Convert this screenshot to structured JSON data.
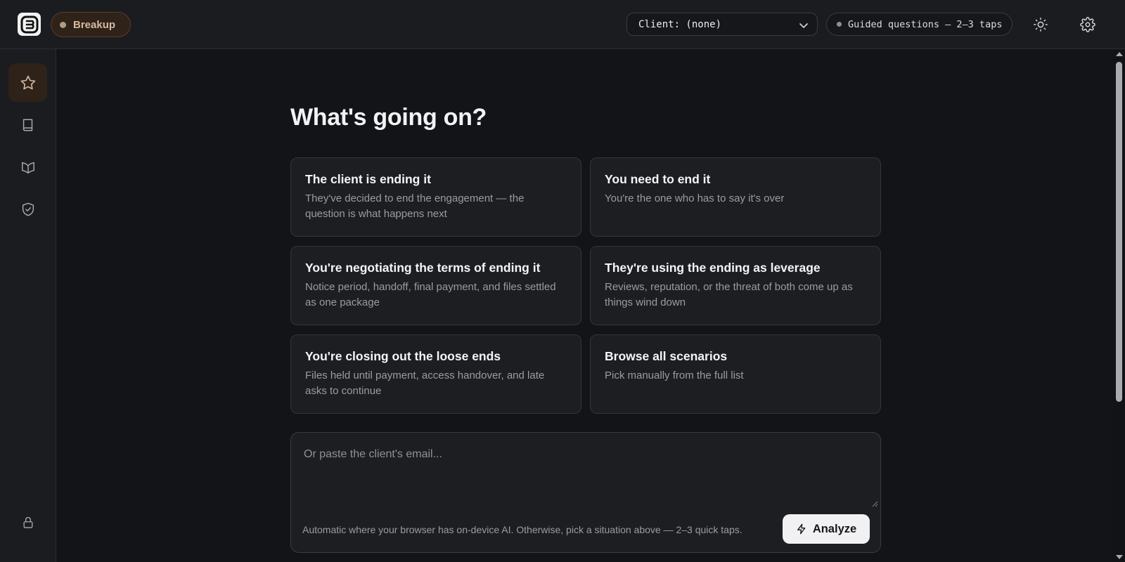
{
  "header": {
    "logo_icon": "brand-logo-icon",
    "mode_label": "Breakup",
    "client_select": {
      "value": "Client: (none)"
    },
    "guided_label": "Guided questions — 2–3 taps",
    "theme_icon": "sun-icon",
    "settings_icon": "gear-icon"
  },
  "sidebar": {
    "items": [
      {
        "icon": "star-icon",
        "active": true
      },
      {
        "icon": "book-icon",
        "active": false
      },
      {
        "icon": "open-book-icon",
        "active": false
      },
      {
        "icon": "shield-check-icon",
        "active": false
      }
    ],
    "bottom_icon": "lock-icon"
  },
  "main": {
    "title": "What's going on?",
    "cards": [
      {
        "title": "The client is ending it",
        "desc": "They've decided to end the engagement — the question is what happens next"
      },
      {
        "title": "You need to end it",
        "desc": "You're the one who has to say it's over"
      },
      {
        "title": "You're negotiating the terms of ending it",
        "desc": "Notice period, handoff, final payment, and files settled as one package"
      },
      {
        "title": "They're using the ending as leverage",
        "desc": "Reviews, reputation, or the threat of both come up as things wind down"
      },
      {
        "title": "You're closing out the loose ends",
        "desc": "Files held until payment, access handover, and late asks to continue"
      },
      {
        "title": "Browse all scenarios",
        "desc": "Pick manually from the full list"
      }
    ],
    "paste": {
      "placeholder": "Or paste the client's email...",
      "value": "",
      "hint": "Automatic where your browser has on-device AI. Otherwise, pick a situation above — 2–3 quick taps.",
      "analyze_label": "Analyze",
      "analyze_icon": "lightning-icon"
    }
  },
  "colors": {
    "background": "#131418",
    "panel": "#1a1c20",
    "card": "#1c1e22",
    "accent_pill": "#2f2219",
    "accent_text": "#d7b99e"
  }
}
